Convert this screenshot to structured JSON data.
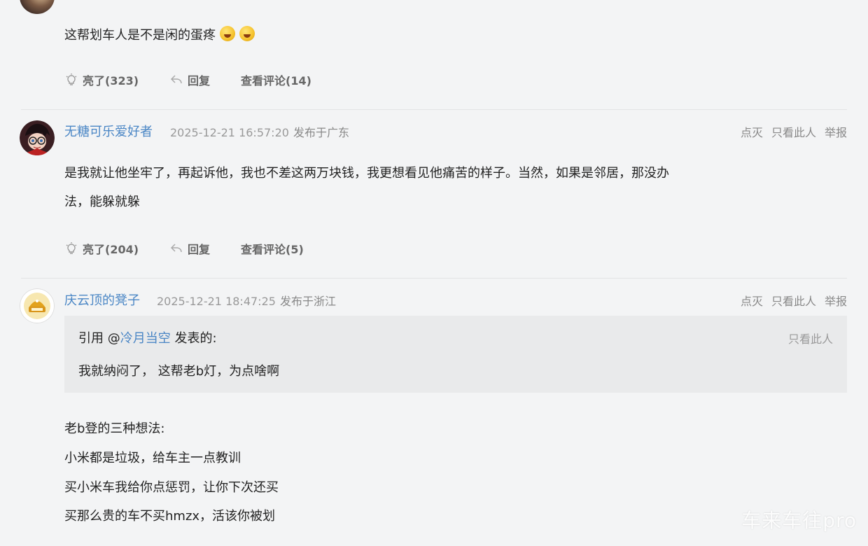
{
  "comments": [
    {
      "text": "这帮划车人是不是闲的蛋疼",
      "actions": {
        "like": "亮了(323)",
        "reply": "回复",
        "view": "查看评论(14)"
      }
    },
    {
      "username": "无糖可乐爱好者",
      "timestamp": "2025-12-21 16:57:20",
      "location": "发布于广东",
      "right_actions": {
        "dislike": "点灭",
        "only_this": "只看此人",
        "report": "举报"
      },
      "text_line1": "是我就让他坐牢了，再起诉他，我也不差这两万块钱，我更想看见他痛苦的样子。当然，如果是邻居，那没办",
      "text_line2": "法，能躲就躲",
      "actions": {
        "like": "亮了(204)",
        "reply": "回复",
        "view": "查看评论(5)"
      }
    },
    {
      "username": "庆云顶的凳子",
      "timestamp": "2025-12-21 18:47:25",
      "location": "发布于浙江",
      "right_actions": {
        "dislike": "点灭",
        "only_this": "只看此人",
        "report": "举报"
      },
      "quote": {
        "prefix": "引用 @",
        "user": "冷月当空",
        "suffix": " 发表的:",
        "only_this": "只看此人",
        "text": "我就纳闷了，  这帮老b灯，为点啥啊"
      },
      "lines": [
        "老b登的三种想法:",
        "小米都是垃圾，给车主一点教训",
        "买小米车我给你点惩罚，让你下次还买",
        "买那么贵的车不买hmzx，活该你被划"
      ]
    }
  ],
  "watermark": "车来车往pro"
}
